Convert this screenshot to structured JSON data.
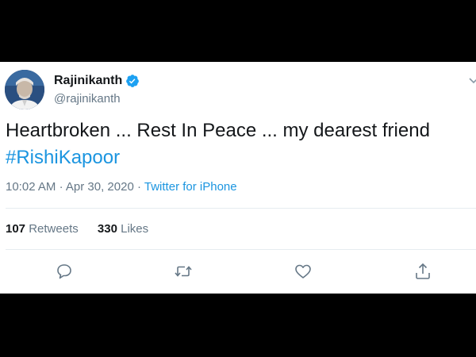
{
  "tweet": {
    "display_name": "Rajinikanth",
    "handle": "@rajinikanth",
    "text_main": "Heartbroken ... Rest In Peace ... my dearest friend",
    "hashtag": "#RishiKapoor",
    "time": "10:02 AM",
    "separator": "·",
    "date": "Apr 30, 2020",
    "source": "Twitter for iPhone",
    "retweets_count": "107",
    "retweets_label": "Retweets",
    "likes_count": "330",
    "likes_label": "Likes"
  },
  "icons": {
    "verified": "verified-badge-icon",
    "more": "chevron-down-icon",
    "reply": "reply-icon",
    "retweet": "retweet-icon",
    "like": "heart-icon",
    "share": "share-icon"
  },
  "colors": {
    "accent": "#1b95e0",
    "text": "#14171a",
    "secondary": "#657786",
    "background": "#000000"
  }
}
